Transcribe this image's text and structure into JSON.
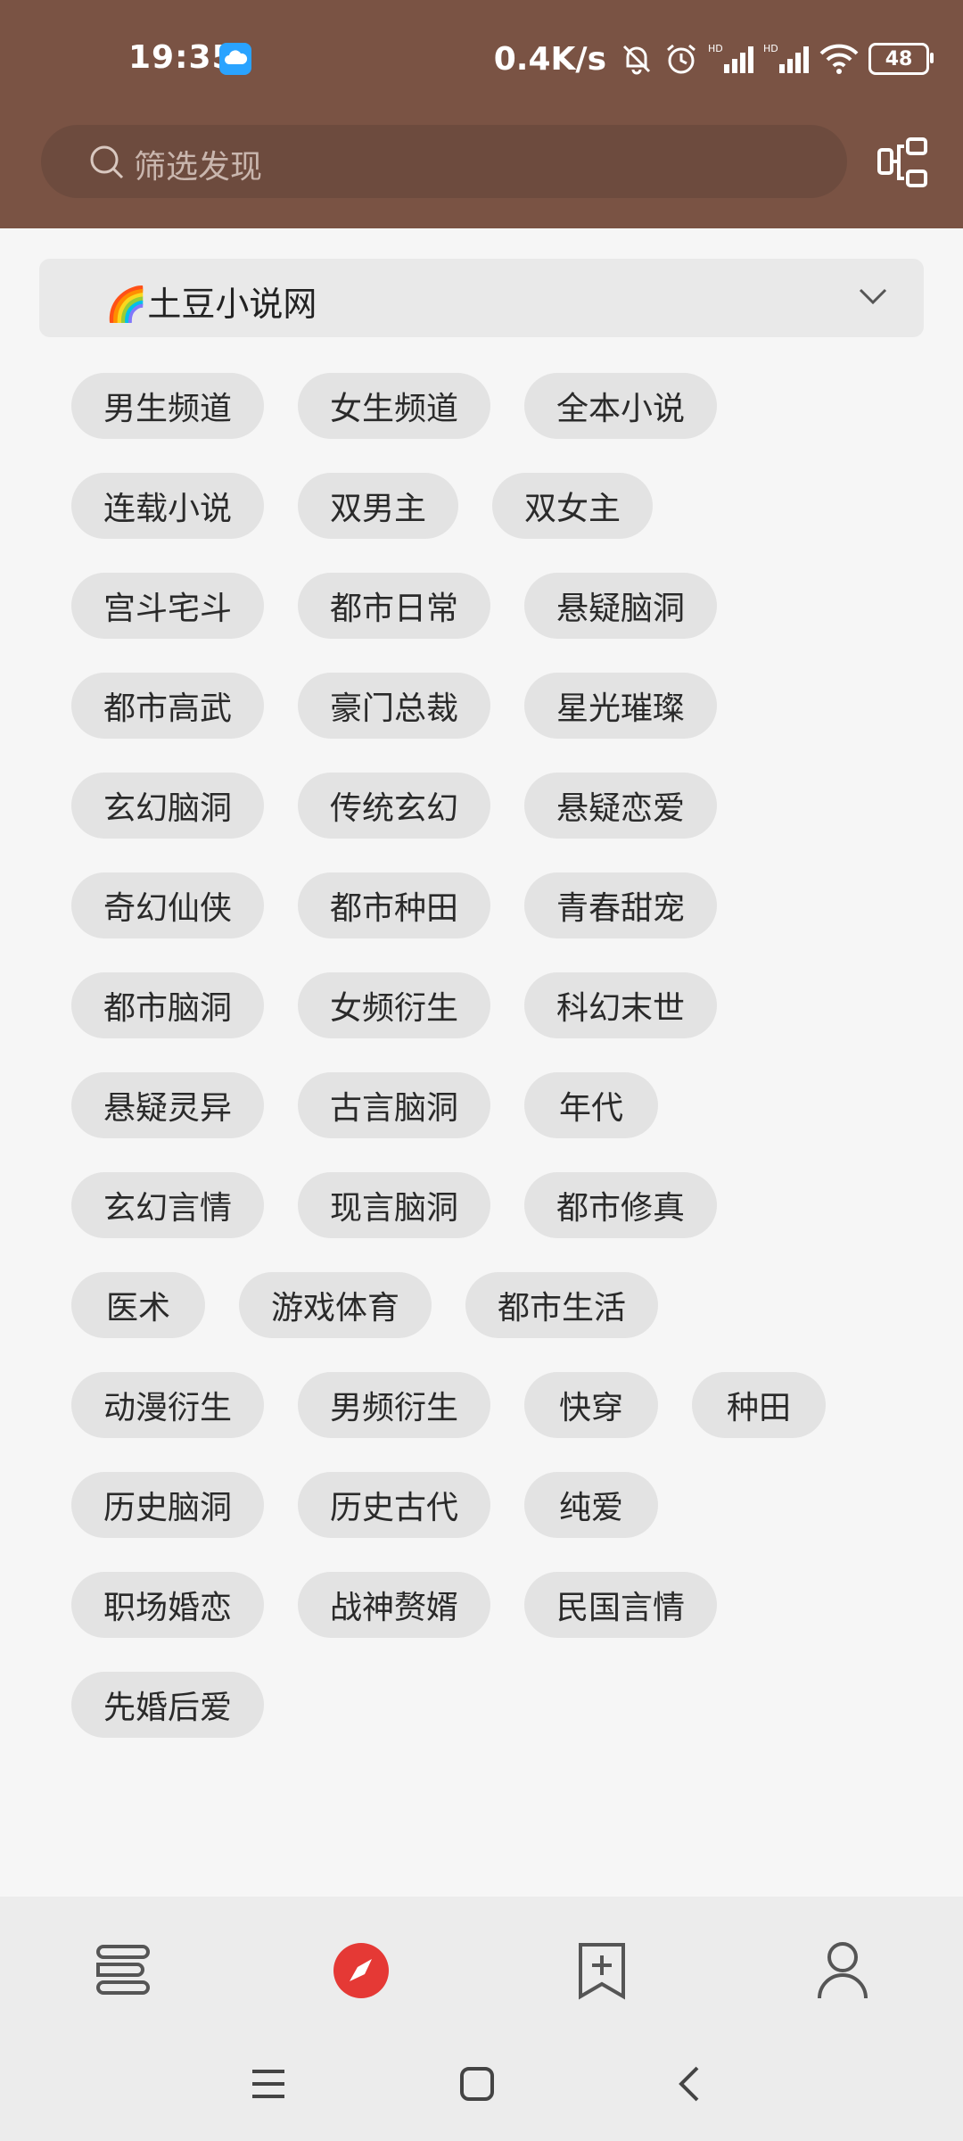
{
  "status_bar": {
    "time": "19:35",
    "speed": "0.4K/s",
    "battery": "48"
  },
  "search": {
    "placeholder": "筛选发现"
  },
  "source": {
    "title": "🌈土豆小说网"
  },
  "tags": [
    [
      "男生频道",
      "女生频道",
      "全本小说"
    ],
    [
      "连载小说",
      "双男主",
      "双女主"
    ],
    [
      "宫斗宅斗",
      "都市日常",
      "悬疑脑洞"
    ],
    [
      "都市高武",
      "豪门总裁",
      "星光璀璨"
    ],
    [
      "玄幻脑洞",
      "传统玄幻",
      "悬疑恋爱"
    ],
    [
      "奇幻仙侠",
      "都市种田",
      "青春甜宠"
    ],
    [
      "都市脑洞",
      "女频衍生",
      "科幻末世"
    ],
    [
      "悬疑灵异",
      "古言脑洞",
      "年代"
    ],
    [
      "玄幻言情",
      "现言脑洞",
      "都市修真"
    ],
    [
      "医术",
      "游戏体育",
      "都市生活"
    ],
    [
      "动漫衍生",
      "男频衍生",
      "快穿",
      "种田"
    ],
    [
      "历史脑洞",
      "历史古代",
      "纯爱"
    ],
    [
      "职场婚恋",
      "战神赘婿",
      "民国言情"
    ],
    [
      "先婚后爱"
    ]
  ],
  "colors": {
    "header": "#7a5344",
    "accent": "#e53935"
  },
  "icons": {
    "bookshelf": "bookshelf-icon",
    "discover": "compass-icon",
    "rss": "bookmark-add-icon",
    "profile": "user-icon"
  }
}
